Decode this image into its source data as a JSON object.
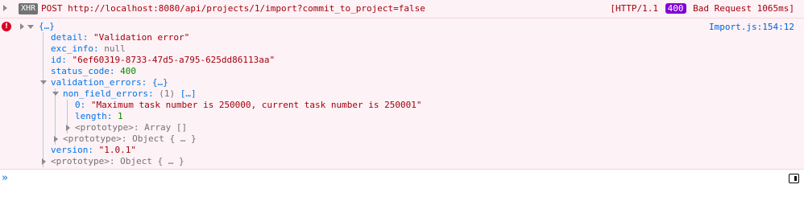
{
  "request": {
    "badge": "XHR",
    "method_url": "POST http://localhost:8080/api/projects/1/import?commit_to_project=false",
    "status_prefix": "[HTTP/1.1",
    "status_code": "400",
    "status_suffix": "Bad Request 1065ms]"
  },
  "error": {
    "icon_glyph": "!",
    "source": "Import.js:154:12",
    "root": "{…}",
    "detail_key": "detail:",
    "detail_val": "\"Validation error\"",
    "exc_info_key": "exc_info:",
    "exc_info_val": "null",
    "id_key": "id:",
    "id_val": "\"6ef60319-8733-47d5-a795-625dd86113aa\"",
    "status_code_key": "status_code:",
    "status_code_val": "400",
    "validation_errors_key": "validation_errors:",
    "validation_errors_val": "{…}",
    "non_field_errors_key": "non_field_errors:",
    "non_field_errors_count": "(1)",
    "non_field_errors_val": "[…]",
    "item0_key": "0:",
    "item0_val": "\"Maximum task number is 250000, current task number is 250001\"",
    "length_key": "length:",
    "length_val": "1",
    "array_proto_key": "<prototype>:",
    "array_proto_val": "Array []",
    "ve_proto_key": "<prototype>:",
    "ve_proto_val": "Object { … }",
    "version_key": "version:",
    "version_val": "\"1.0.1\"",
    "root_proto_key": "<prototype>:",
    "root_proto_val": "Object { … }"
  },
  "console_input": {
    "prompt": "»",
    "value": ""
  },
  "colors": {
    "error_bg": "#fdf2f5",
    "error_text": "#a4000f",
    "status_badge": "#8000d7",
    "key": "#0074e8",
    "number": "#058b00"
  }
}
